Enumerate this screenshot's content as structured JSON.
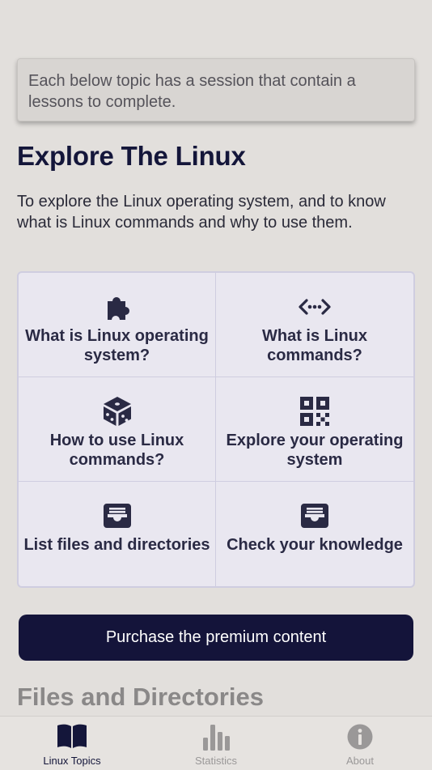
{
  "notice": "Each below topic has a session that contain a lessons to complete.",
  "page": {
    "title": "Explore The Linux",
    "intro": "To explore the Linux operating system, and to know what is Linux commands and why to use them."
  },
  "topics": [
    {
      "label": "What is Linux operating system?",
      "icon": "puzzle-icon"
    },
    {
      "label": "What is Linux commands?",
      "icon": "code-arrows-icon"
    },
    {
      "label": "How to use Linux commands?",
      "icon": "dice-icon"
    },
    {
      "label": "Explore your operating system",
      "icon": "qr-code-icon"
    },
    {
      "label": "List files and directories",
      "icon": "inbox-tray-icon"
    },
    {
      "label": "Check your knowledge",
      "icon": "inbox-tray-icon"
    }
  ],
  "premium_button": "Purchase the premium content",
  "next_section": "Files and Directories",
  "tabbar": {
    "items": [
      {
        "label": "Linux Topics",
        "icon": "open-book-icon",
        "active": true
      },
      {
        "label": "Statistics",
        "icon": "bar-chart-icon",
        "active": false
      },
      {
        "label": "About",
        "icon": "info-icon",
        "active": false
      }
    ]
  },
  "colors": {
    "background": "#e2dfdc",
    "accent": "#14143a",
    "tile_background": "#e9e7f0",
    "inactive_tab": "#9a9898"
  }
}
